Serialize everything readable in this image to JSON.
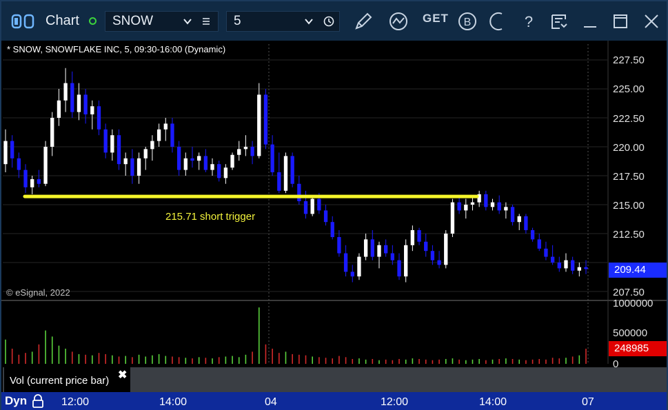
{
  "titlebar": {
    "title": "Chart",
    "symbol": "SNOW",
    "interval": "5",
    "get_label": "GET",
    "icons": [
      "window-sync-icon",
      "list-icon",
      "clock-icon",
      "draw-pen-icon",
      "study-icon",
      "get-icon",
      "b-badge-icon",
      "moon-icon",
      "help-icon",
      "page-icon",
      "minimize-icon",
      "maximize-icon",
      "close-icon"
    ]
  },
  "chart": {
    "header": "* SNOW, SNOWFLAKE INC, 5, 09:30-16:00 (Dynamic)",
    "watermark": "© eSignal, 2022",
    "trigger_label": "215.71 short trigger",
    "last_price": "209.44",
    "price_ticks": [
      "227.50",
      "225.00",
      "222.50",
      "220.00",
      "217.50",
      "215.00",
      "212.50",
      "207.50"
    ],
    "colors": {
      "up_candle": "#ffffff",
      "down_candle": "#1a1aff",
      "trigger_line": "#f5f52a",
      "last_price_badge": "#1a2cff",
      "volume_badge": "#e00000"
    }
  },
  "volume": {
    "label": "Vol (current price bar)",
    "close_label": "✖",
    "last_volume": "248985",
    "ticks": [
      "1000000",
      "500000",
      "0"
    ]
  },
  "timebar": {
    "dyn_label": "Dyn",
    "ticks": [
      "12:00",
      "14:00",
      "04",
      "12:00",
      "14:00",
      "07"
    ]
  },
  "chart_data": {
    "type": "candlestick",
    "ylim": [
      206.5,
      229
    ],
    "horizontal_level": 215.71,
    "candles": [
      [
        218.5,
        221.5,
        217.8,
        220.5
      ],
      [
        220.5,
        221,
        218.2,
        219
      ],
      [
        219,
        219.5,
        217.3,
        218
      ],
      [
        218,
        218.5,
        216,
        216.5
      ],
      [
        216.5,
        217.5,
        215.9,
        217.2
      ],
      [
        217.2,
        218,
        216.5,
        216.8
      ],
      [
        216.8,
        220.5,
        216.6,
        220
      ],
      [
        220,
        223,
        219.2,
        222.5
      ],
      [
        222.5,
        225,
        221.8,
        224
      ],
      [
        224,
        226.8,
        223,
        225.5
      ],
      [
        225.5,
        226.5,
        222.5,
        223
      ],
      [
        223,
        225.5,
        222.3,
        224.5
      ],
      [
        224.5,
        225,
        222,
        222.8
      ],
      [
        222.8,
        224,
        221.5,
        223.5
      ],
      [
        223.5,
        224,
        221,
        221.5
      ],
      [
        221.5,
        222,
        219,
        219.5
      ],
      [
        219.5,
        221.5,
        218.8,
        221
      ],
      [
        221,
        221.5,
        218,
        218.5
      ],
      [
        218.5,
        219.5,
        217.5,
        219
      ],
      [
        219,
        219.8,
        216.8,
        217.5
      ],
      [
        217.5,
        219.5,
        216.8,
        219
      ],
      [
        219,
        220,
        218,
        219.8
      ],
      [
        219.8,
        221,
        218.8,
        220.5
      ],
      [
        220.5,
        222,
        220,
        221.5
      ],
      [
        221.5,
        222.5,
        220.5,
        222
      ],
      [
        222,
        222.5,
        219.5,
        220
      ],
      [
        220,
        220.5,
        217.5,
        218
      ],
      [
        218,
        219.5,
        217.5,
        219
      ],
      [
        219,
        220,
        218.2,
        218.8
      ],
      [
        218.8,
        219.5,
        218,
        219.2
      ],
      [
        219.2,
        219.8,
        217.8,
        218
      ],
      [
        218,
        219,
        217.5,
        218.5
      ],
      [
        218.5,
        218.8,
        217,
        217.3
      ],
      [
        217.3,
        218.5,
        216.8,
        218.2
      ],
      [
        218.2,
        219.5,
        218,
        219.3
      ],
      [
        219.3,
        220.5,
        218.8,
        219.8
      ],
      [
        219.8,
        221,
        219.2,
        220
      ],
      [
        220,
        220.5,
        218.5,
        219.2
      ],
      [
        219.2,
        225.5,
        219,
        224.5
      ],
      [
        224.5,
        225,
        219.8,
        220.2
      ],
      [
        220.2,
        221,
        217.5,
        217.8
      ],
      [
        217.8,
        219.5,
        216,
        216.2
      ],
      [
        216.2,
        219.5,
        216,
        219.2
      ],
      [
        219.2,
        219.5,
        216.5,
        216.8
      ],
      [
        216.8,
        217.5,
        215,
        215.3
      ],
      [
        215.3,
        216.2,
        213.8,
        214.2
      ],
      [
        214.2,
        215.8,
        214,
        215.5
      ],
      [
        215.5,
        216,
        214.2,
        214.5
      ],
      [
        214.5,
        215,
        213.2,
        213.5
      ],
      [
        213.5,
        214,
        212,
        212.2
      ],
      [
        212.2,
        212.8,
        210.5,
        210.8
      ],
      [
        210.8,
        211.5,
        208.8,
        209.2
      ],
      [
        209.2,
        209.8,
        208.3,
        208.8
      ],
      [
        208.8,
        210.8,
        208.5,
        210.5
      ],
      [
        210.5,
        212.5,
        210.2,
        212
      ],
      [
        212,
        212.8,
        210.2,
        210.5
      ],
      [
        210.5,
        211.8,
        209.5,
        211.5
      ],
      [
        211.5,
        212,
        210.5,
        210.8
      ],
      [
        210.8,
        211.5,
        209.8,
        210.2
      ],
      [
        210.2,
        210.8,
        208.5,
        208.8
      ],
      [
        208.8,
        212,
        208.3,
        211.5
      ],
      [
        211.5,
        213.2,
        211,
        212.8
      ],
      [
        212.8,
        213,
        211.5,
        211.8
      ],
      [
        211.8,
        212.5,
        210.5,
        211
      ],
      [
        211,
        211.5,
        209.8,
        210.2
      ],
      [
        210.2,
        211,
        209.5,
        209.8
      ],
      [
        209.8,
        212.8,
        209.5,
        212.5
      ],
      [
        212.5,
        215.5,
        212.2,
        215.2
      ],
      [
        215.2,
        215.8,
        214.2,
        214.5
      ],
      [
        214.5,
        215.5,
        213.8,
        215
      ],
      [
        215,
        215.8,
        214.5,
        215.2
      ],
      [
        215.2,
        216.2,
        214.8,
        215.9
      ],
      [
        215.9,
        216.2,
        214.5,
        214.8
      ],
      [
        214.8,
        215.5,
        214.5,
        215.2
      ],
      [
        215.2,
        215.8,
        214.2,
        214.5
      ],
      [
        214.5,
        215.2,
        213.8,
        214.8
      ],
      [
        214.8,
        215,
        213.2,
        213.5
      ],
      [
        213.5,
        214.2,
        212.8,
        214
      ],
      [
        214,
        214.2,
        212.5,
        212.8
      ],
      [
        212.8,
        213,
        211.8,
        212
      ],
      [
        212,
        212.5,
        211,
        211.2
      ],
      [
        211.2,
        211.8,
        210.2,
        210.5
      ],
      [
        210.5,
        211.5,
        209.8,
        210
      ],
      [
        210,
        210.5,
        209.2,
        209.5
      ],
      [
        209.5,
        210.8,
        209.2,
        210.2
      ],
      [
        210.2,
        210.5,
        209,
        209.3
      ],
      [
        209.3,
        210,
        208.8,
        209.6
      ],
      [
        209.6,
        210.2,
        209,
        209.44
      ]
    ],
    "volume": [
      400000,
      250000,
      150000,
      180000,
      200000,
      320000,
      550000,
      450000,
      300000,
      250000,
      200000,
      160000,
      150000,
      140000,
      180000,
      160000,
      140000,
      120000,
      130000,
      110000,
      150000,
      120000,
      140000,
      160000,
      130000,
      120000,
      110000,
      100000,
      90000,
      110000,
      100000,
      90000,
      110000,
      120000,
      130000,
      110000,
      150000,
      200000,
      930000,
      320000,
      250000,
      180000,
      200000,
      160000,
      150000,
      140000,
      120000,
      110000,
      100000,
      90000,
      130000,
      110000,
      80000,
      90000,
      70000,
      80000,
      60000,
      70000,
      60000,
      80000,
      70000,
      90000,
      80000,
      70000,
      60000,
      70000,
      80000,
      90000,
      70000,
      60000,
      70000,
      80000,
      60000,
      70000,
      80000,
      90000,
      80000,
      70000,
      60000,
      70000,
      80000,
      70000,
      100000,
      90000,
      100000,
      120000,
      140000,
      248985
    ]
  }
}
